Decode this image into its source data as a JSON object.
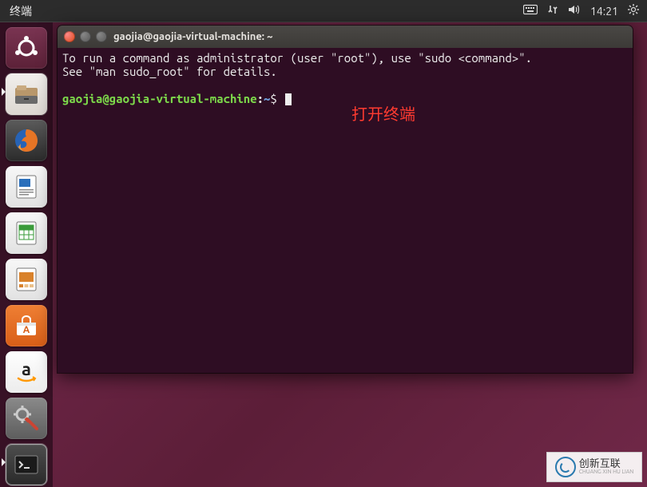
{
  "menubar": {
    "app_name": "终端",
    "time": "14:21"
  },
  "launcher": {
    "items": [
      {
        "name": "dash-icon"
      },
      {
        "name": "files-icon"
      },
      {
        "name": "firefox-icon"
      },
      {
        "name": "libreoffice-writer-icon"
      },
      {
        "name": "libreoffice-calc-icon"
      },
      {
        "name": "libreoffice-impress-icon"
      },
      {
        "name": "ubuntu-software-icon"
      },
      {
        "name": "amazon-icon"
      },
      {
        "name": "system-settings-icon"
      },
      {
        "name": "terminal-icon"
      }
    ]
  },
  "terminal": {
    "title": "gaojia@gaojia-virtual-machine: ~",
    "output_line1": "To run a command as administrator (user \"root\"), use \"sudo <command>\".",
    "output_line2": "See \"man sudo_root\" for details.",
    "prompt_user": "gaojia@gaojia-virtual-machine",
    "prompt_colon": ":",
    "prompt_path": "~",
    "prompt_dollar": "$"
  },
  "annotation": "打开终端",
  "watermark": {
    "main": "创新互联",
    "sub": "CHUANG XIN HU LIAN"
  }
}
